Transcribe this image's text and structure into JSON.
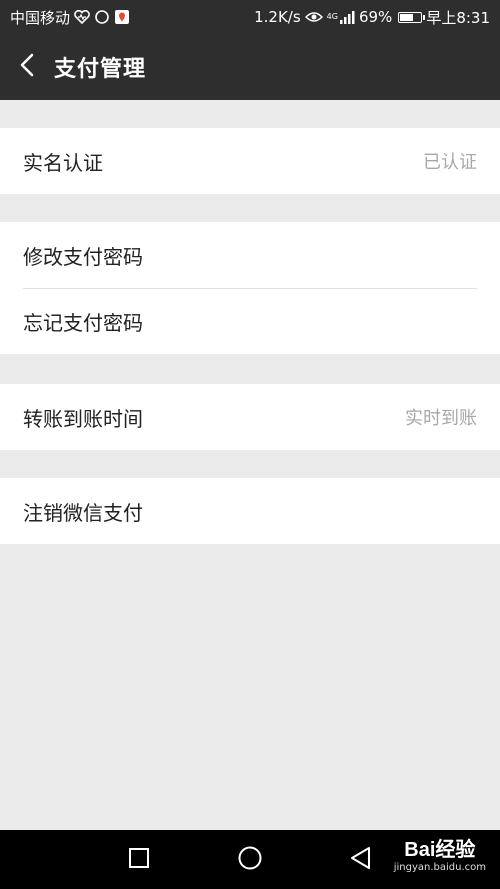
{
  "status_bar": {
    "carrier": "中国移动",
    "speed": "1.2K/s",
    "network": "4G",
    "battery": "69%",
    "battery_level": 0.69,
    "time": "早上8:31",
    "icons": [
      "heart-icon",
      "circle-icon",
      "location-icon",
      "eye-icon",
      "signal-icon",
      "battery-icon"
    ]
  },
  "header": {
    "title": "支付管理",
    "back_icon": "chevron-left-icon"
  },
  "groups": [
    {
      "rows": [
        {
          "label": "实名认证",
          "value": "已认证"
        }
      ]
    },
    {
      "rows": [
        {
          "label": "修改支付密码",
          "value": ""
        },
        {
          "label": "忘记支付密码",
          "value": ""
        }
      ]
    },
    {
      "rows": [
        {
          "label": "转账到账时间",
          "value": "实时到账"
        }
      ]
    },
    {
      "rows": [
        {
          "label": "注销微信支付",
          "value": ""
        }
      ]
    }
  ],
  "nav_bar": {
    "buttons": [
      "recents-square-icon",
      "home-circle-icon",
      "back-triangle-icon"
    ]
  },
  "watermark": {
    "logo": "Bai经验",
    "url": "jingyan.baidu.com"
  },
  "colors": {
    "header_bg": "#2e2e2e",
    "page_bg": "#ebebeb",
    "row_bg": "#ffffff",
    "value_text": "#a8a8a8"
  }
}
